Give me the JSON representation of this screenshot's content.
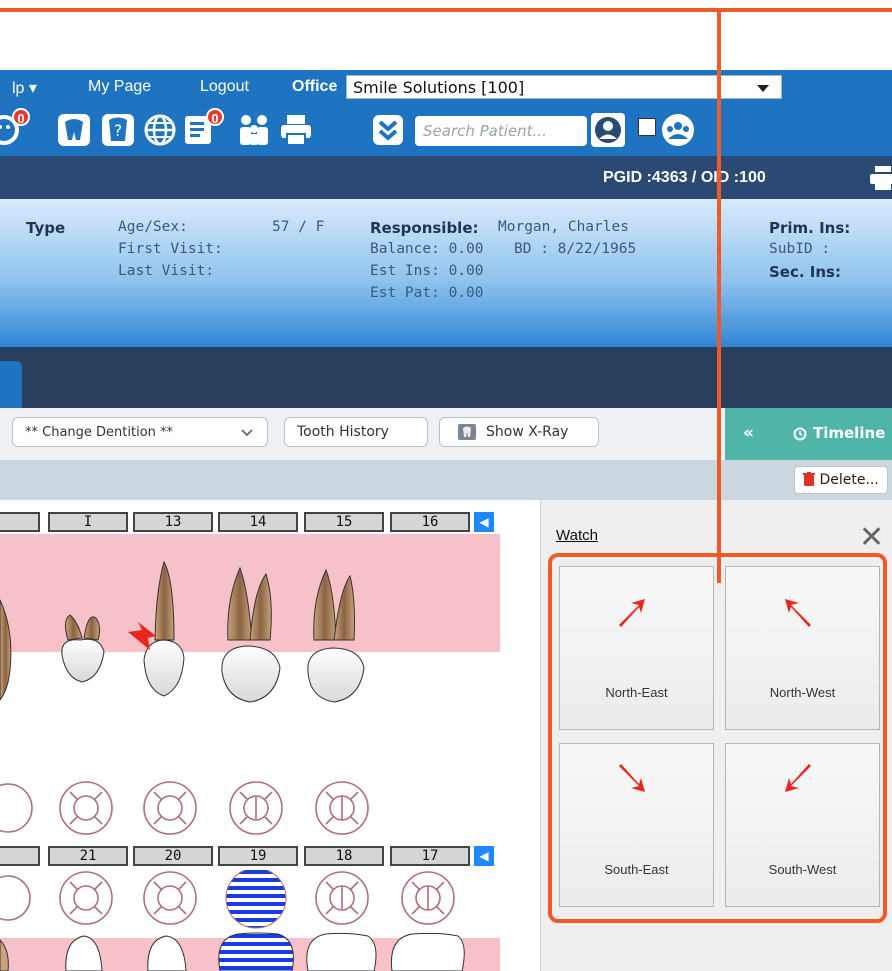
{
  "menu": {
    "help_label": "lp ▾",
    "mypage_label": "My Page",
    "logout_label": "Logout",
    "office_label": "Office",
    "office_value": "Smile Solutions [100]"
  },
  "toolbar": {
    "badge_a": "0",
    "badge_b": "0",
    "search_placeholder": "Search Patient..."
  },
  "idbar": {
    "text": "PGID :4363 / OID :100"
  },
  "patient": {
    "type_label": "Type",
    "age_sex_label": "Age/Sex:",
    "age_sex_value": "57 / F",
    "first_visit_label": "First Visit:",
    "last_visit_label": "Last Visit:",
    "responsible_label": "Responsible:",
    "responsible_value": "Morgan, Charles",
    "balance": "Balance: 0.00",
    "bd": "BD : 8/22/1965",
    "est_ins": "Est Ins:  0.00",
    "est_pat": "Est Pat: 0.00",
    "prim_ins_label": "Prim. Ins:",
    "subid_label": "SubID :",
    "sec_ins_label": "Sec. Ins:"
  },
  "tools": {
    "dentition": "** Change Dentition **",
    "tooth_history": "Tooth History",
    "show_xray": "Show X-Ray",
    "collapse": "«",
    "timeline": "Timeline",
    "delete": "Delete..."
  },
  "chart": {
    "upper_numbers": [
      "",
      "I",
      "13",
      "14",
      "15",
      "16"
    ],
    "lower_numbers": [
      "",
      "21",
      "20",
      "19",
      "18",
      "17"
    ],
    "nav": "◀"
  },
  "watch": {
    "title": "Watch",
    "close": "✕",
    "buttons": [
      "North-East",
      "North-West",
      "South-East",
      "South-West"
    ]
  },
  "colors": {
    "accent_orange": "#f05a28",
    "menubar_blue": "#1f74c2",
    "navy": "#2a4a73",
    "timeline_teal": "#4fb5a9",
    "arrow_red": "#e8261f",
    "band_pink": "#f7c1c9"
  }
}
